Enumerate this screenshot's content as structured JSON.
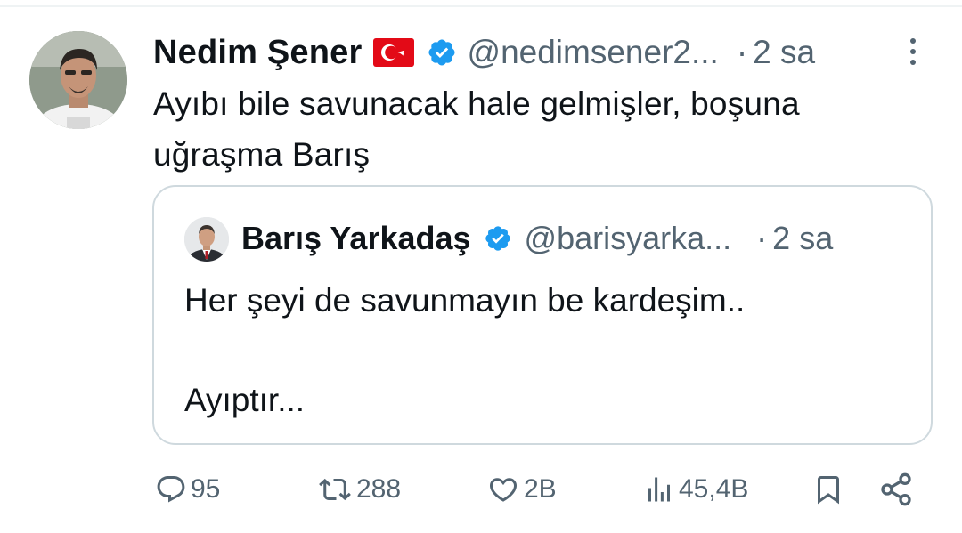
{
  "tweet": {
    "author": {
      "name": "Nedim Şener",
      "flag": "turkey-flag-icon",
      "verified": true,
      "handle": "@nedimsener2...",
      "time_separator": "·",
      "time": "2 sa"
    },
    "text_lines": [
      "Ayıbı bile savunacak hale gelmişler, boşuna",
      "uğraşma Barış"
    ]
  },
  "quoted": {
    "author": {
      "name": "Barış Yarkadaş",
      "verified": true,
      "handle": "@barisyarka...",
      "time_separator": "·",
      "time": "2 sa"
    },
    "text_lines": [
      "Her şeyi de savunmayın be kardeşim..",
      "",
      "Ayıptır..."
    ]
  },
  "actions": {
    "replies": "95",
    "retweets": "288",
    "likes": "2B",
    "views": "45,4B"
  },
  "colors": {
    "text": "#0f1419",
    "secondary": "#536471",
    "verified": "#1d9bf0",
    "border": "#cfd9de",
    "flag_red": "#e30a17"
  },
  "icons": [
    "more-icon",
    "verified-badge-icon",
    "reply-icon",
    "retweet-icon",
    "like-icon",
    "views-icon",
    "bookmark-icon",
    "share-icon"
  ]
}
